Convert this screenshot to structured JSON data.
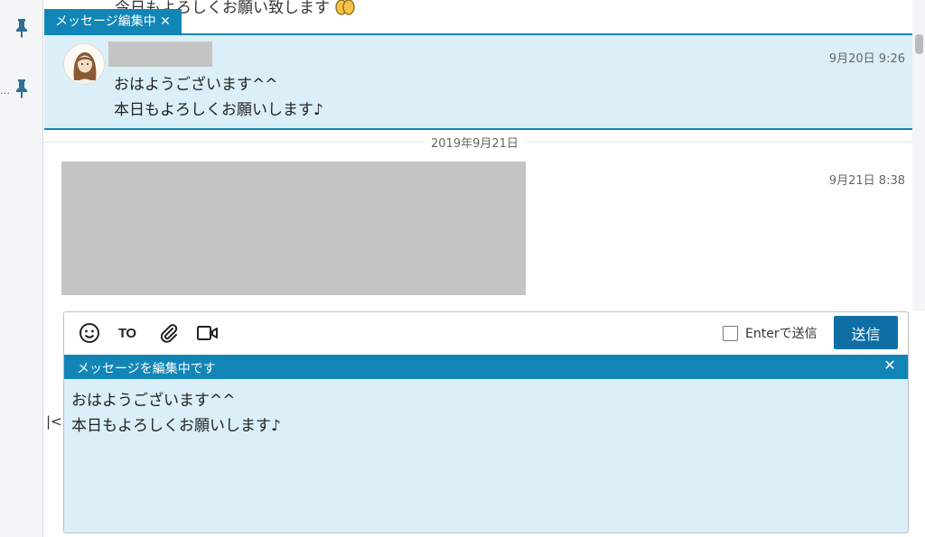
{
  "timeline": {
    "previous_message_partial": "今日もよろしくお願い致します",
    "editing_tag": "メッセージ編集中 ✕",
    "editing_message": {
      "time": "9月20日 9:26",
      "lines": [
        "おはようございます^^",
        "本日もよろしくお願いします♪"
      ]
    },
    "date_divider": "2019年9月21日",
    "image_message": {
      "time": "9月21日 8:38"
    }
  },
  "composer": {
    "toolbar": {
      "to_label": "TO",
      "enter_send_label": "Enterで送信",
      "send_button": "送信"
    },
    "edit_banner": "メッセージを編集中です",
    "close_glyph": "✕",
    "text": "おはようございます^^\n本日もよろしくお願いします♪"
  },
  "sidebar": {
    "dots": "…",
    "collapse_glyph": "|<"
  },
  "colors": {
    "accent": "#1186b6",
    "edit_background": "#dbeff8",
    "send_button": "#0f6fa5"
  },
  "icons": [
    "pin-icon",
    "emoji-icon",
    "attach-icon",
    "video-call-icon",
    "close-icon",
    "clapping-hands-icon",
    "collapse-icon"
  ]
}
